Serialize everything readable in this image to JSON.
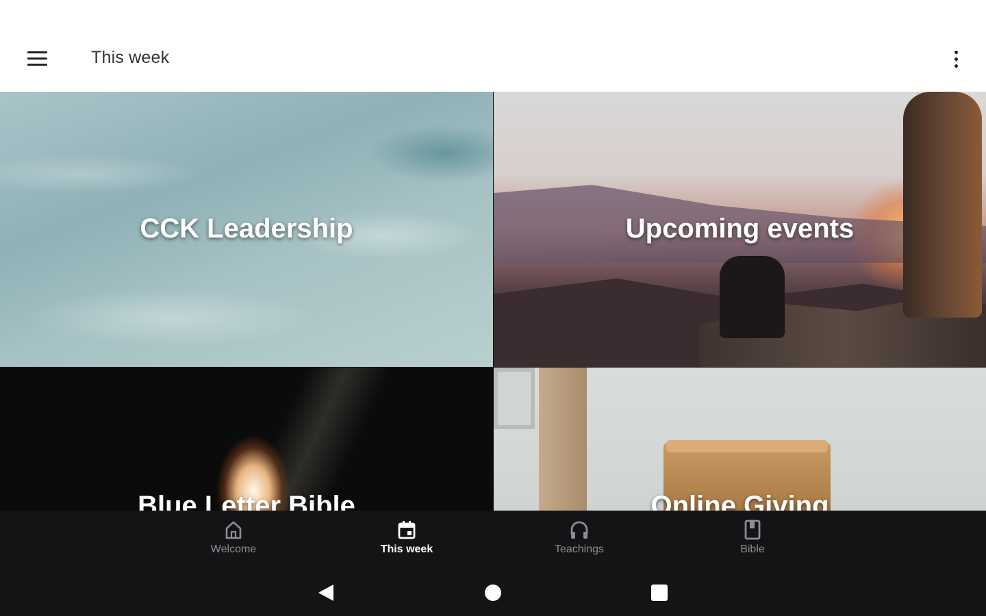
{
  "app_bar": {
    "title": "This week"
  },
  "tiles": [
    {
      "label": "CCK Leadership"
    },
    {
      "label": "Upcoming events"
    },
    {
      "label": "Blue Letter Bible"
    },
    {
      "label": "Online Giving"
    }
  ],
  "bottom_nav": {
    "items": [
      {
        "label": "Welcome",
        "icon": "home-icon",
        "active": false
      },
      {
        "label": "This week",
        "icon": "calendar-icon",
        "active": true
      },
      {
        "label": "Teachings",
        "icon": "headphones-icon",
        "active": false
      },
      {
        "label": "Bible",
        "icon": "book-icon",
        "active": false
      }
    ]
  },
  "colors": {
    "nav_background": "#141416",
    "nav_active": "#ffffff",
    "nav_inactive": "#8e8e92"
  }
}
